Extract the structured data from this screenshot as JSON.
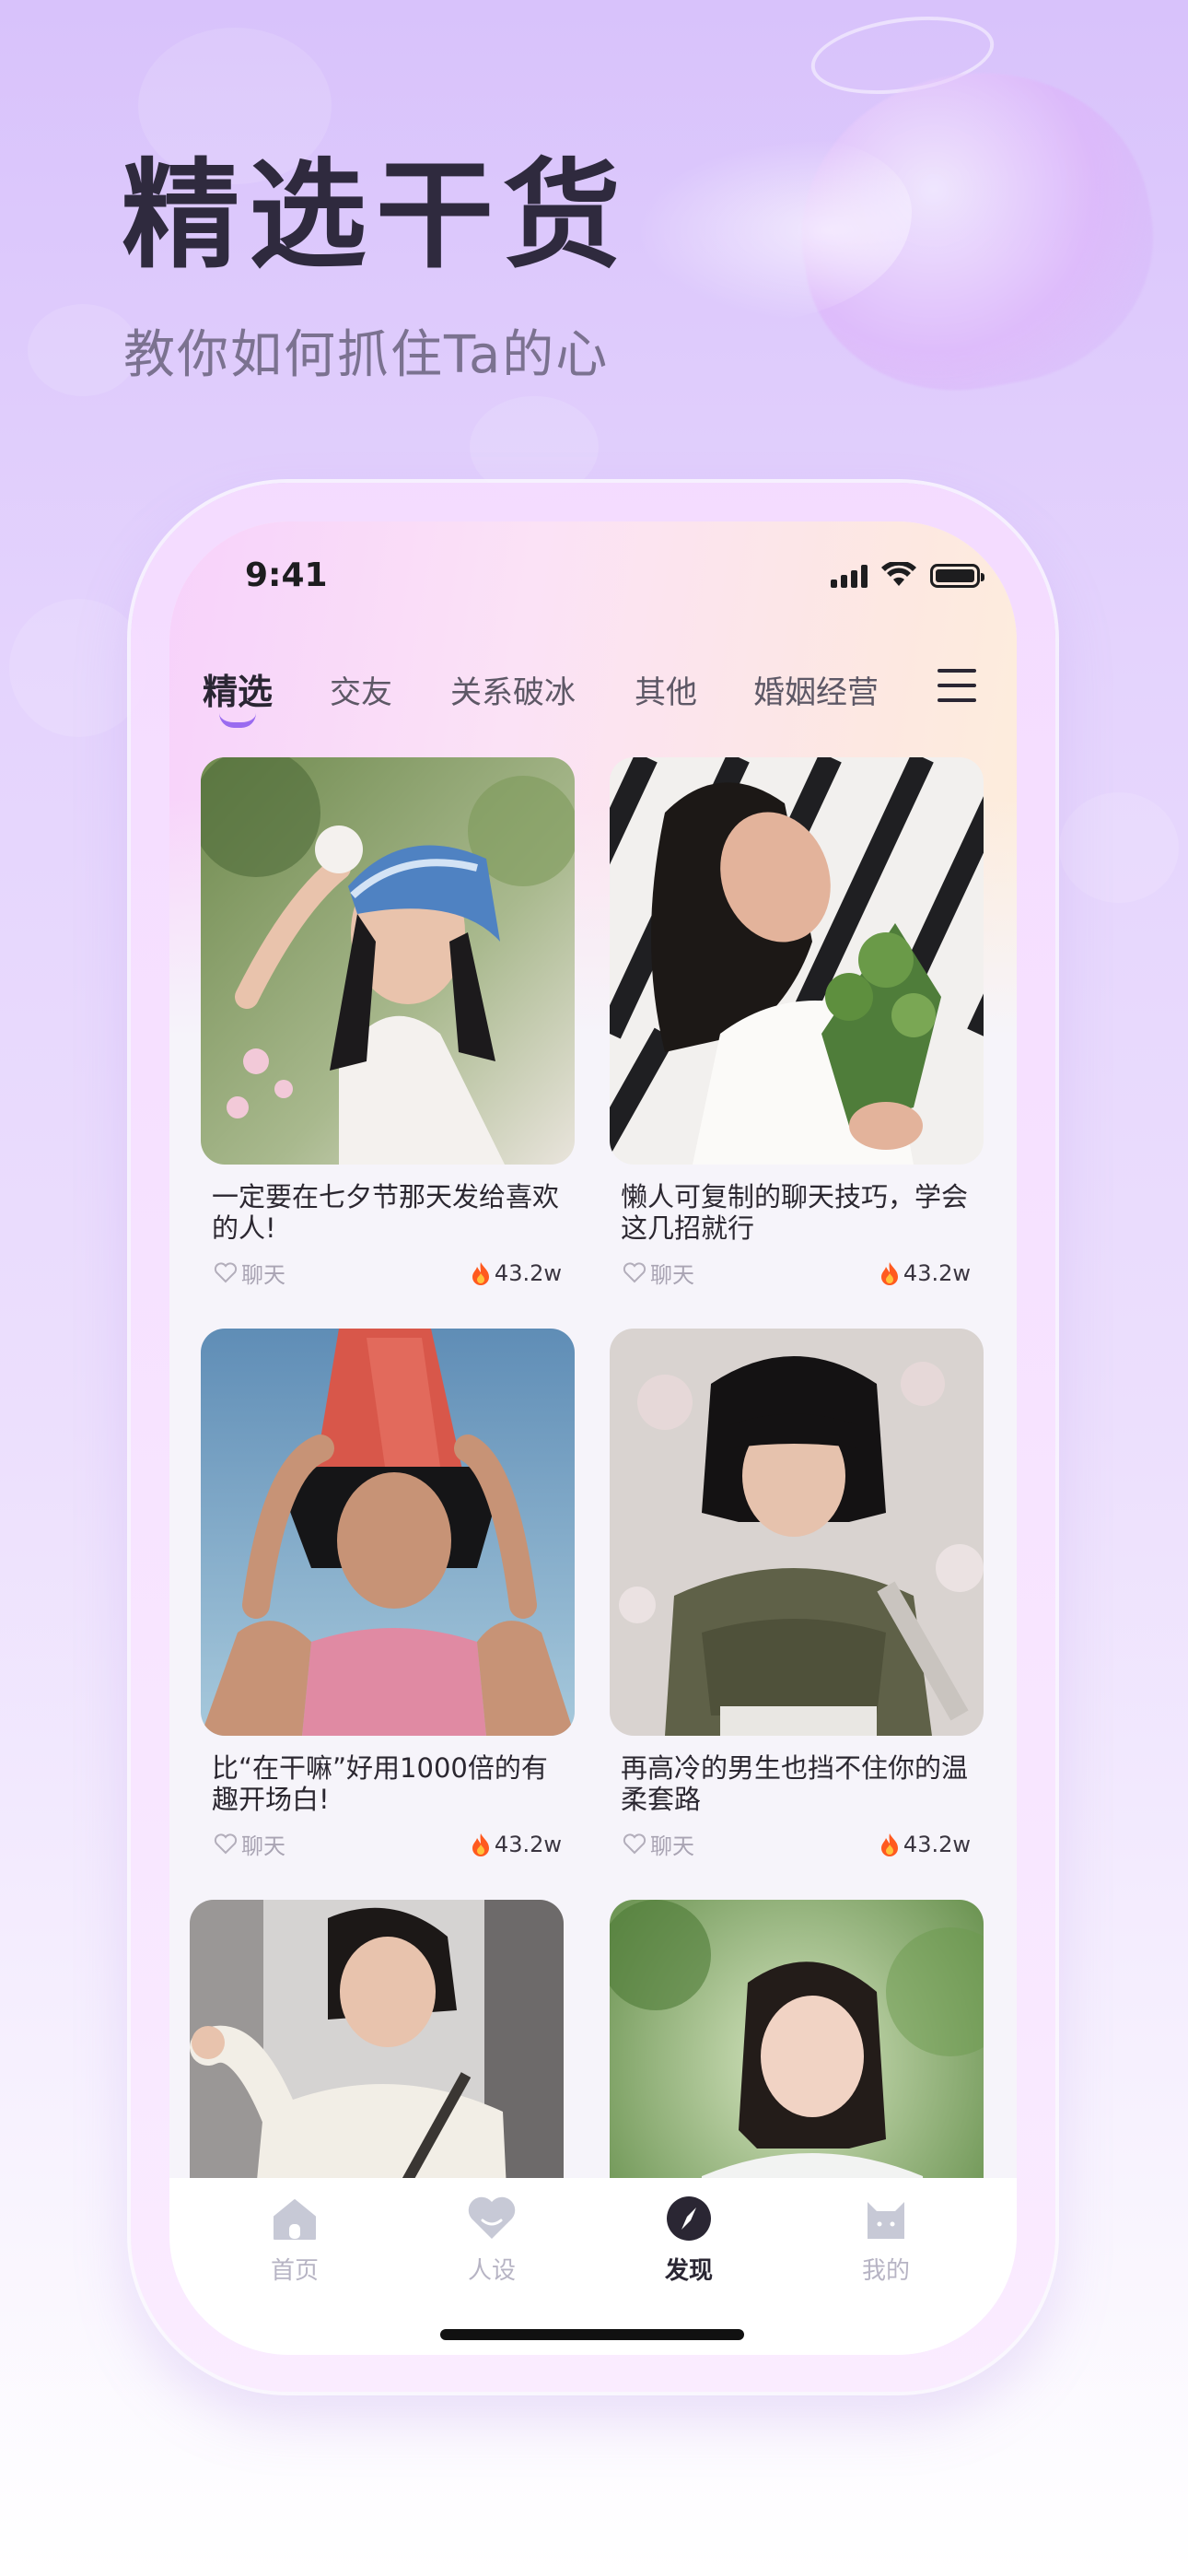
{
  "hero": {
    "title": "精选干货",
    "subtitle": "教你如何抓住Ta的心"
  },
  "status_bar": {
    "time": "9:41"
  },
  "tabs": [
    {
      "label": "精选",
      "active": true
    },
    {
      "label": "交友",
      "active": false
    },
    {
      "label": "关系破冰",
      "active": false
    },
    {
      "label": "其他",
      "active": false
    },
    {
      "label": "婚姻经营",
      "active": false
    }
  ],
  "menu_icon": "hamburger-menu-icon",
  "cards": [
    {
      "title": "一定要在七夕节那天发给喜欢的人!",
      "tag": "聊天",
      "hot": "43.2w",
      "image": "photo-girl-blue-hat"
    },
    {
      "title": "懒人可复制的聊天技巧，学会这几招就行",
      "tag": "聊天",
      "hot": "43.2w",
      "image": "photo-girl-flowers"
    },
    {
      "title": "比“在干嘛”好用1000倍的有趣开场白!",
      "tag": "聊天",
      "hot": "43.2w",
      "image": "photo-girl-red-bag-hat"
    },
    {
      "title": "再高冷的男生也挡不住你的温柔套路",
      "tag": "聊天",
      "hot": "43.2w",
      "image": "photo-girl-green-jacket"
    },
    {
      "title": "",
      "tag": "",
      "hot": "",
      "image": "photo-girl-white-sweater"
    },
    {
      "title": "",
      "tag": "",
      "hot": "",
      "image": "photo-girl-garden"
    }
  ],
  "tab_bar": [
    {
      "label": "首页",
      "icon": "home-icon",
      "active": false
    },
    {
      "label": "人设",
      "icon": "heart-face-icon",
      "active": false
    },
    {
      "label": "发现",
      "icon": "compass-icon",
      "active": true
    },
    {
      "label": "我的",
      "icon": "cat-profile-icon",
      "active": false
    }
  ],
  "colors": {
    "accent": "#9a6bf0",
    "title": "#2f2a3e",
    "hot_fire": "#ff5a1f",
    "inactive_tab": "#b7b4c4"
  }
}
